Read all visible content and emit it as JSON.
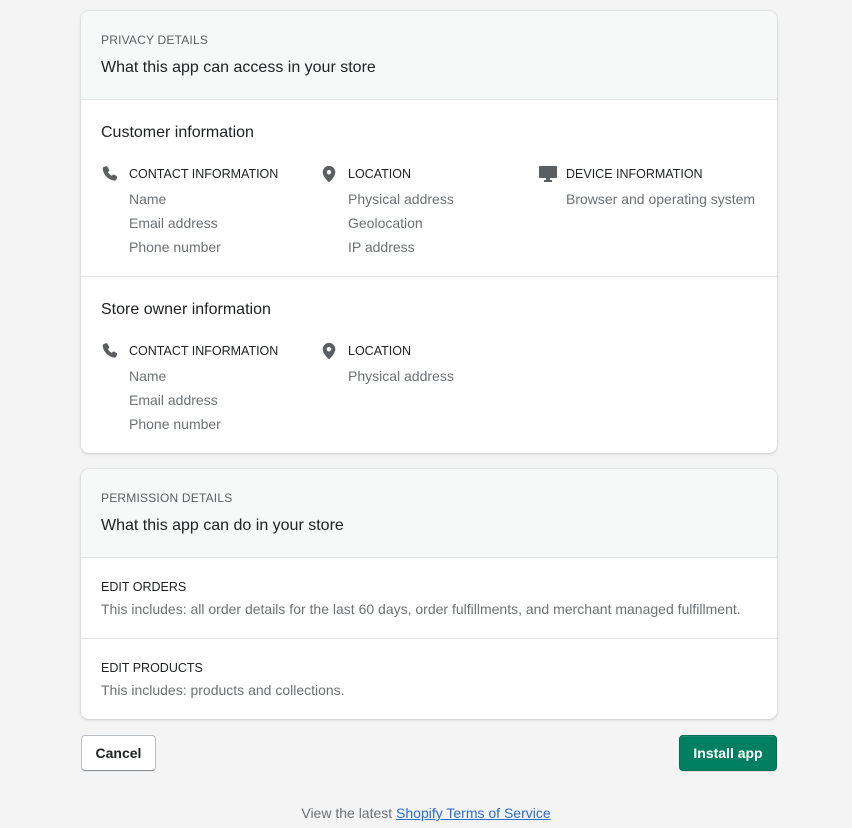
{
  "privacy": {
    "eyebrow": "PRIVACY DETAILS",
    "title": "What this app can access in your store",
    "customer": {
      "title": "Customer information",
      "columns": [
        {
          "icon": "phone-icon",
          "title": "CONTACT INFORMATION",
          "items": [
            "Name",
            "Email address",
            "Phone number"
          ]
        },
        {
          "icon": "location-pin-icon",
          "title": "LOCATION",
          "items": [
            "Physical address",
            "Geolocation",
            "IP address"
          ]
        },
        {
          "icon": "monitor-icon",
          "title": "DEVICE INFORMATION",
          "items": [
            "Browser and operating system"
          ]
        }
      ]
    },
    "store_owner": {
      "title": "Store owner information",
      "columns": [
        {
          "icon": "phone-icon",
          "title": "CONTACT INFORMATION",
          "items": [
            "Name",
            "Email address",
            "Phone number"
          ]
        },
        {
          "icon": "location-pin-icon",
          "title": "LOCATION",
          "items": [
            "Physical address"
          ]
        }
      ]
    }
  },
  "permissions": {
    "eyebrow": "PERMISSION DETAILS",
    "title": "What this app can do in your store",
    "items": [
      {
        "title": "EDIT ORDERS",
        "description": "This includes: all order details for the last 60 days, order fulfillments, and merchant managed fulfillment."
      },
      {
        "title": "EDIT PRODUCTS",
        "description": "This includes: products and collections."
      }
    ]
  },
  "actions": {
    "cancel_label": "Cancel",
    "install_label": "Install app"
  },
  "footer": {
    "prefix": "View the latest ",
    "link_text": "Shopify Terms of Service"
  },
  "colors": {
    "primary": "#008060",
    "link": "#2c6ecb",
    "subdued_text": "#6d7175",
    "background": "#f4f4f4"
  }
}
